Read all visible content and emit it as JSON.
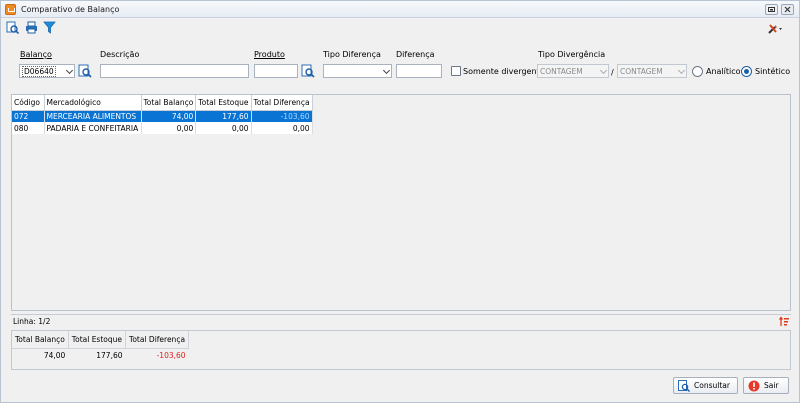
{
  "window": {
    "title": "Comparativo de Balanço"
  },
  "filters": {
    "balanco": {
      "label": "Balanço",
      "value": "D06640"
    },
    "descricao": {
      "label": "Descrição",
      "value": ""
    },
    "produto": {
      "label": "Produto",
      "value": ""
    },
    "tipo_diferenca": {
      "label": "Tipo Diferença",
      "value": ""
    },
    "diferenca": {
      "label": "Diferença",
      "value": ""
    },
    "somente_divergentes": {
      "label": "Somente divergentes",
      "checked": false
    },
    "tipo_divergencia": {
      "label": "Tipo Divergência",
      "value1": "CONTAGEM",
      "separator": "/",
      "value2": "CONTAGEM"
    },
    "analitico": {
      "label": "Analítico",
      "checked": false
    },
    "sintetico": {
      "label": "Sintético",
      "checked": true
    }
  },
  "grid": {
    "columns": [
      "Código",
      "Mercadológico",
      "Total Balanço",
      "Total Estoque",
      "Total Diferença"
    ],
    "rows": [
      {
        "codigo": "072",
        "mercadologico": "MERCEARIA ALIMENTOS",
        "total_balanco": "74,00",
        "total_estoque": "177,60",
        "total_diferenca": "-103,60",
        "selected": true
      },
      {
        "codigo": "080",
        "mercadologico": "PADARIA E CONFEITARIA",
        "total_balanco": "0,00",
        "total_estoque": "0,00",
        "total_diferenca": "0,00",
        "selected": false
      }
    ]
  },
  "status": {
    "linha": "Linha: 1/2"
  },
  "totals": {
    "columns": [
      "Total Balanço",
      "Total Estoque",
      "Total Diferença"
    ],
    "values": [
      "74,00",
      "177,60",
      "-103,60"
    ]
  },
  "buttons": {
    "consultar": "Consultar",
    "sair": "Sair"
  },
  "colors": {
    "selection": "#0a74d4",
    "negative": "#d22222",
    "accent": "#1d5ea8"
  }
}
